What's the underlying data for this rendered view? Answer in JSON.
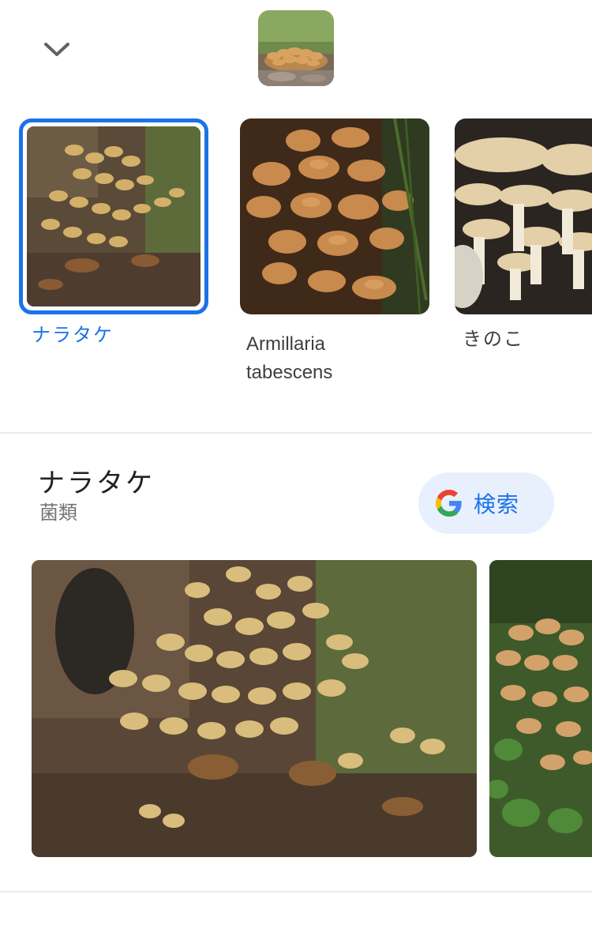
{
  "header": {
    "collapse_icon": "chevron-down-icon",
    "query_image": "mushroom-cluster-thumbnail"
  },
  "candidates": [
    {
      "label": "ナラタケ",
      "selected": true
    },
    {
      "label_line1": "Armillaria",
      "label_line2": "tabescens",
      "selected": false
    },
    {
      "label": "きのこ",
      "selected": false
    }
  ],
  "entity": {
    "title": "ナラタケ",
    "subtitle": "菌類",
    "search_button": {
      "label": "検索",
      "icon": "google-g-icon"
    }
  },
  "colors": {
    "accent": "#1a73e8",
    "search_button_bg": "#e8f0fe",
    "divider": "#e8eaed",
    "subtitle": "#70757a"
  }
}
